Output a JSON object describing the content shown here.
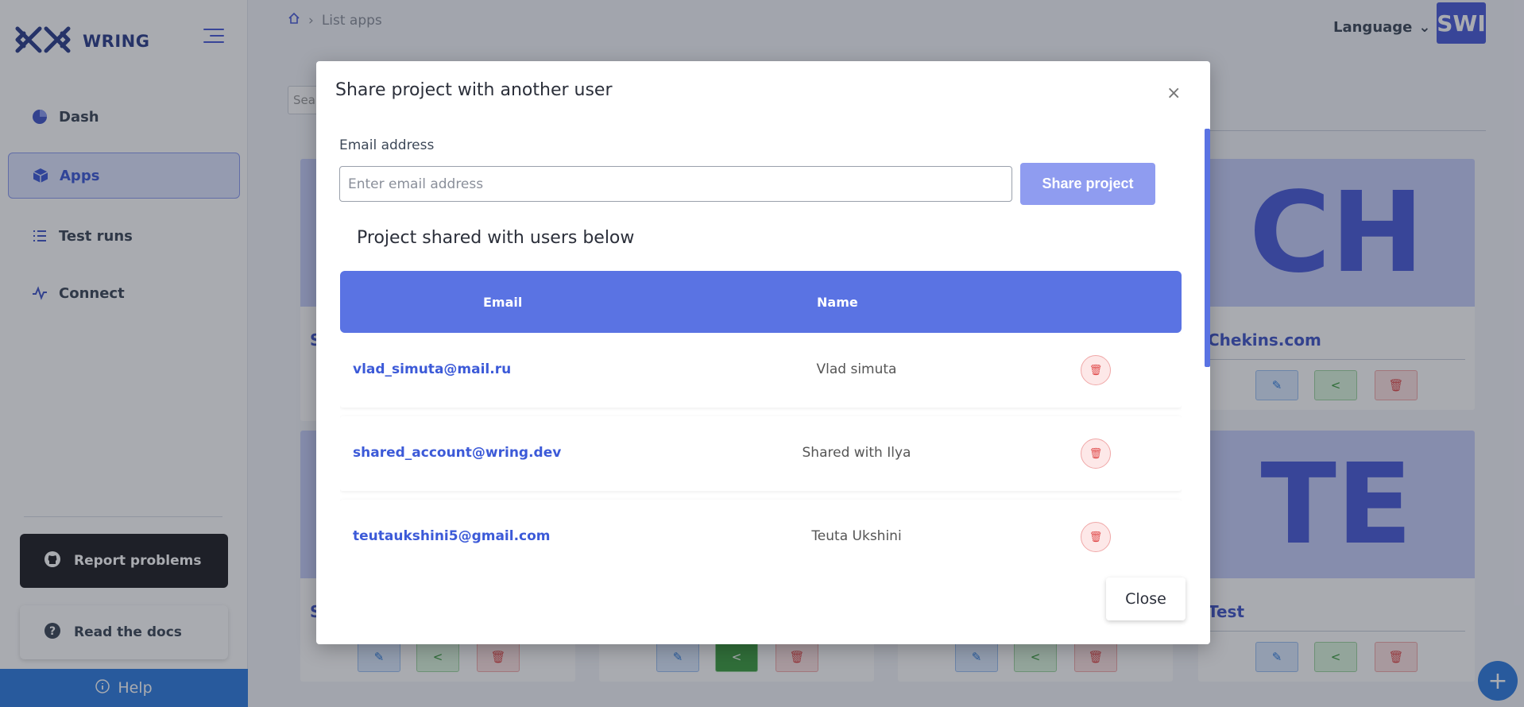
{
  "sidebar": {
    "brand": "WRING",
    "nav": [
      {
        "label": "Dash",
        "icon": "pie-chart-icon"
      },
      {
        "label": "Apps",
        "icon": "box-icon"
      },
      {
        "label": "Test runs",
        "icon": "list-icon"
      },
      {
        "label": "Connect",
        "icon": "activity-icon"
      }
    ],
    "report_label": "Report problems",
    "docs_label": "Read the docs",
    "help_label": "Help"
  },
  "header": {
    "breadcrumb_current": "List apps",
    "language_label": "Language",
    "avatar_initials": "SWI",
    "search_placeholder": "Search"
  },
  "background_cards": [
    {
      "initials": "CH",
      "title": "Chekins.com"
    },
    {
      "initials": "TE",
      "title": "Test"
    },
    {
      "title_partial": "S"
    },
    {
      "title_partial": "S"
    }
  ],
  "modal": {
    "title": "Share project with another user",
    "close_x": "×",
    "email_label": "Email address",
    "email_placeholder": "Enter email address",
    "email_value": "",
    "share_button": "Share project",
    "section_title": "Project shared with users below",
    "table_headers": {
      "email": "Email",
      "name": "Name"
    },
    "rows": [
      {
        "email": "vlad_simuta@mail.ru",
        "name": "Vlad simuta"
      },
      {
        "email": "shared_account@wring.dev",
        "name": "Shared with Ilya"
      },
      {
        "email": "teutaukshini5@gmail.com",
        "name": "Teuta Ukshini"
      }
    ],
    "close_button": "Close"
  },
  "colors": {
    "accent": "#5a73e3",
    "brand": "#2c3e8c",
    "danger": "#e04a4a",
    "success": "#3c9d40",
    "help": "#2f7de0"
  }
}
